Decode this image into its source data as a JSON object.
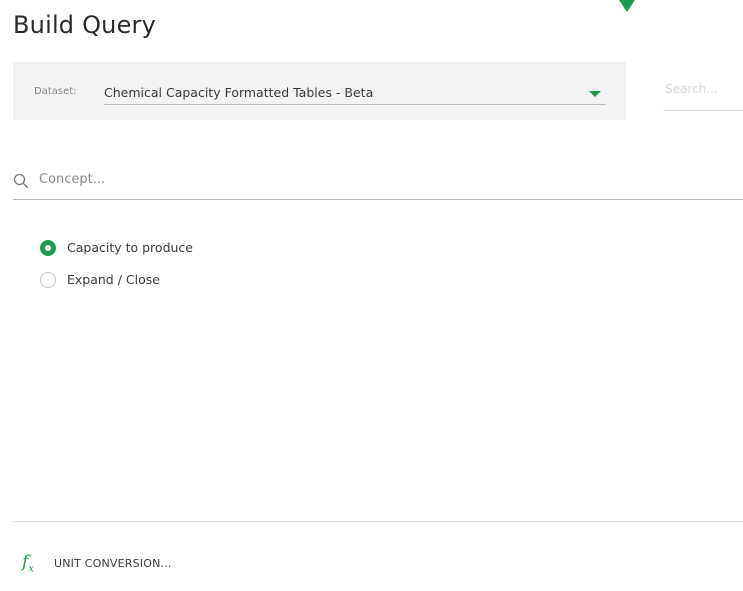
{
  "page": {
    "title": "Build Query"
  },
  "dataset": {
    "label": "Dataset:",
    "selected": "Chemical Capacity Formatted Tables - Beta"
  },
  "search": {
    "placeholder": "Search..."
  },
  "concept": {
    "placeholder": "Concept..."
  },
  "options": [
    {
      "label": "Capacity to produce",
      "checked": true
    },
    {
      "label": "Expand / Close",
      "checked": false
    }
  ],
  "footer": {
    "unit_conversion_label": "UNIT CONVERSION..."
  },
  "colors": {
    "accent": "#1f9b4f",
    "panel": "#f3f3f3"
  },
  "icons": {
    "top": "arrow-down-icon",
    "caret": "chevron-down-icon",
    "concept": "search-icon",
    "unit": "function-icon"
  }
}
